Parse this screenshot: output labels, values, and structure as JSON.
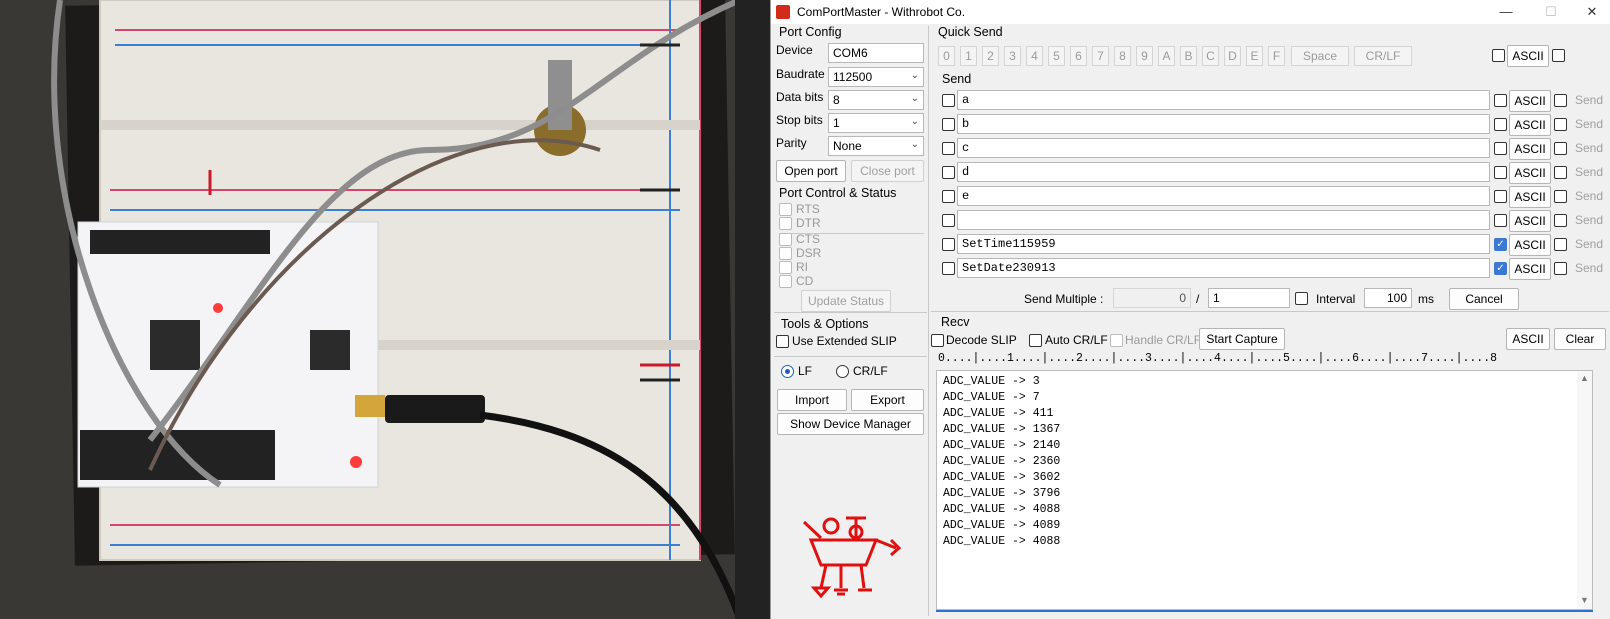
{
  "photo": {
    "alt_icon": "breadboard-photo"
  },
  "window": {
    "title": "ComPortMaster - Withrobot Co.",
    "app_icon": "comportmaster-app-icon",
    "controls": {
      "minimize": "—",
      "maximize": "☐",
      "close": "✕"
    }
  },
  "port_config": {
    "heading": "Port Config",
    "device_label": "Device",
    "device_value": "COM6",
    "baudrate_label": "Baudrate",
    "baudrate_value": "112500",
    "databits_label": "Data bits",
    "databits_value": "8",
    "stopbits_label": "Stop bits",
    "stopbits_value": "1",
    "parity_label": "Parity",
    "parity_value": "None",
    "open_port": "Open port",
    "close_port": "Close port"
  },
  "port_control": {
    "heading": "Port Control & Status",
    "rts": "RTS",
    "dtr": "DTR",
    "cts": "CTS",
    "dsr": "DSR",
    "ri": "RI",
    "cd": "CD",
    "update_status": "Update Status"
  },
  "tools": {
    "heading": "Tools & Options",
    "use_extended_slip": "Use Extended SLIP",
    "lf": "LF",
    "crlf": "CR/LF",
    "import": "Import",
    "export": "Export",
    "show_device_manager": "Show Device Manager"
  },
  "quick_send": {
    "heading": "Quick Send",
    "keys": [
      "0",
      "1",
      "2",
      "3",
      "4",
      "5",
      "6",
      "7",
      "8",
      "9",
      "A",
      "B",
      "C",
      "D",
      "E",
      "F"
    ],
    "space": "Space",
    "crlf": "CR/LF",
    "ascii": "ASCII"
  },
  "send": {
    "heading": "Send",
    "ascii": "ASCII",
    "send_btn": "Send",
    "rows": [
      {
        "text": "a",
        "ascii_checked": false
      },
      {
        "text": "b",
        "ascii_checked": false
      },
      {
        "text": "c",
        "ascii_checked": false
      },
      {
        "text": "d",
        "ascii_checked": false
      },
      {
        "text": "e",
        "ascii_checked": false
      },
      {
        "text": "",
        "ascii_checked": false
      },
      {
        "text": "SetTime115959",
        "ascii_checked": true
      },
      {
        "text": "SetDate230913",
        "ascii_checked": true
      }
    ],
    "send_multiple_label": "Send Multiple :",
    "send_multiple_done": "0",
    "slash": "/",
    "send_multiple_total": "1",
    "interval_label": "Interval",
    "interval_value": "100",
    "interval_unit": "ms",
    "cancel": "Cancel"
  },
  "recv": {
    "heading": "Recv",
    "decode_slip": "Decode SLIP",
    "auto_crlf": "Auto CR/LF",
    "handle_crlf": "Handle CR/LF",
    "start_capture": "Start Capture",
    "ascii": "ASCII",
    "clear": "Clear",
    "ruler": "0....|....1....|....2....|....3....|....4....|....5....|....6....|....7....|....8",
    "lines": [
      "ADC_VALUE -> 3",
      "ADC_VALUE -> 7",
      "ADC_VALUE -> 411",
      "ADC_VALUE -> 1367",
      "ADC_VALUE -> 2140",
      "ADC_VALUE -> 2360",
      "ADC_VALUE -> 3602",
      "ADC_VALUE -> 3796",
      "ADC_VALUE -> 4088",
      "ADC_VALUE -> 4089",
      "ADC_VALUE -> 4088"
    ]
  },
  "logo": {
    "icon": "withrobot-logo-icon",
    "color": "#e01010"
  }
}
